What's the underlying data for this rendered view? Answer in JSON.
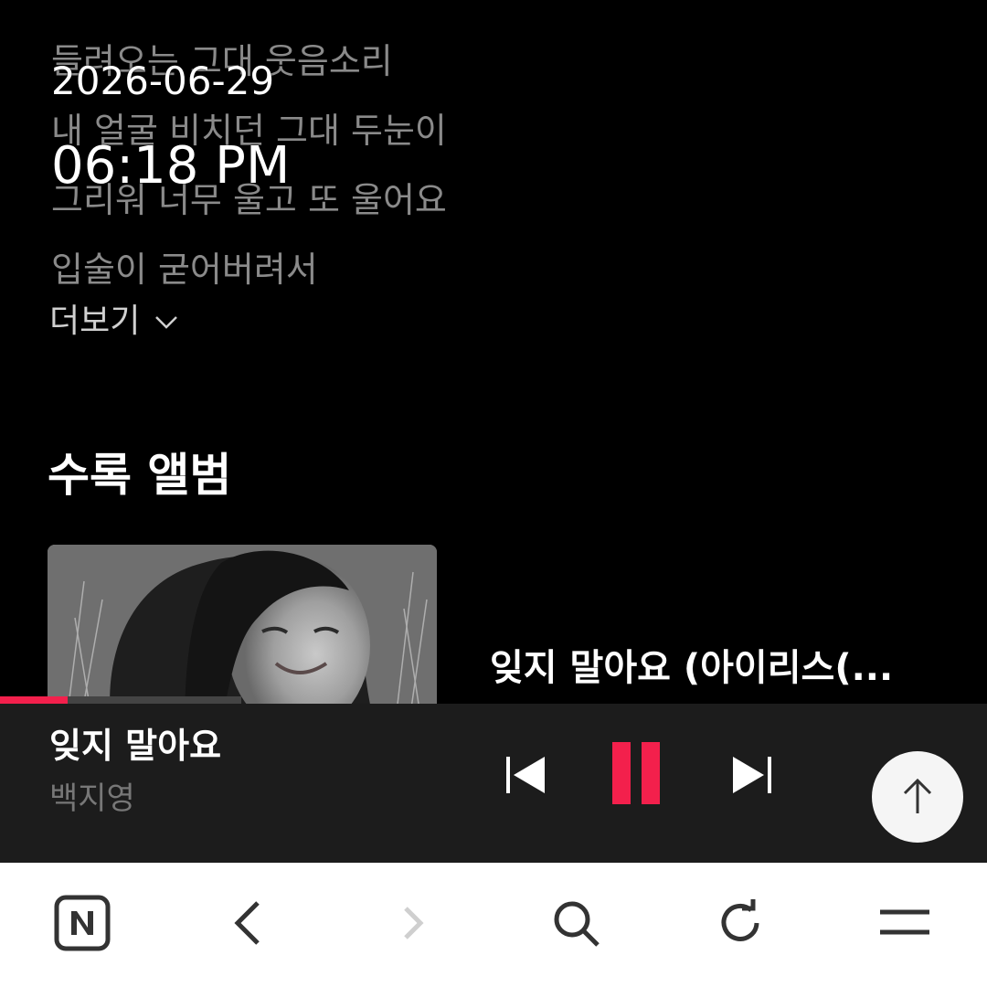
{
  "overlay": {
    "date": "2026-06-29",
    "time": "06:18 PM"
  },
  "lyrics": {
    "lines": [
      "",
      "들려오는 그대 웃음소리",
      "내 얼굴 비치던 그대 두눈이",
      "그리워 너무 울고 또 울어요",
      "입술이 굳어버려서"
    ],
    "more_label": "더보기"
  },
  "album_section": {
    "title": "수록 앨범",
    "album_title": "잊지 말아요 (아이리스(..."
  },
  "player": {
    "track_title": "잊지 말아요",
    "artist": "백지영",
    "progress": 0.28,
    "accent_color": "#f3204c",
    "icons": [
      "previous-icon",
      "pause-icon",
      "next-icon",
      "arrow-up-icon"
    ]
  },
  "browser_bar": {
    "icons": [
      "naver-n-icon",
      "back-icon",
      "forward-icon",
      "search-icon",
      "refresh-icon",
      "menu-icon"
    ]
  }
}
